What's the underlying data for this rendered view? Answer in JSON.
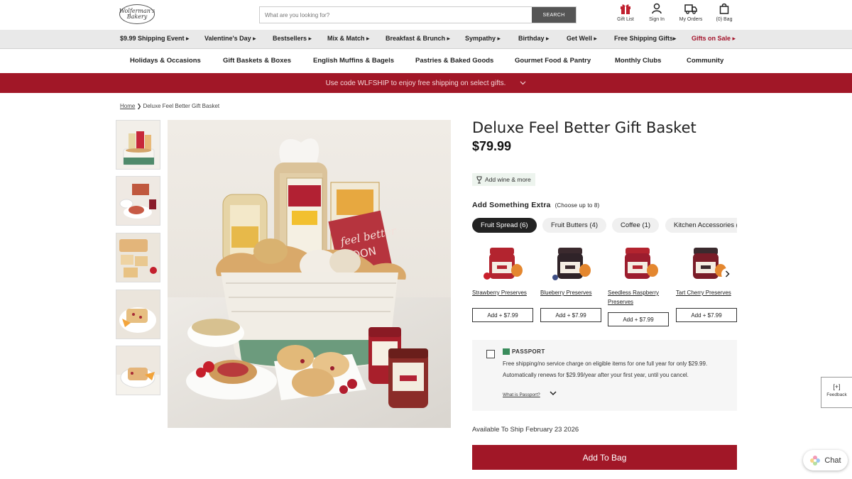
{
  "header": {
    "logo_text": "Wolferman's Bakery",
    "search_placeholder": "What are you looking for?",
    "search_button": "SEARCH",
    "icons": [
      {
        "label": "Gift List",
        "icon": "gift-icon"
      },
      {
        "label": "Sign In",
        "icon": "person-icon"
      },
      {
        "label": "My Orders",
        "icon": "truck-icon"
      },
      {
        "label": "(0) Bag",
        "icon": "bag-icon"
      }
    ]
  },
  "nav_primary": [
    {
      "label": "$9.99 Shipping Event ▸"
    },
    {
      "label": "Valentine's Day ▸"
    },
    {
      "label": "Bestsellers ▸"
    },
    {
      "label": "Mix & Match ▸"
    },
    {
      "label": "Breakfast & Brunch ▸"
    },
    {
      "label": "Sympathy ▸"
    },
    {
      "label": "Birthday ▸"
    },
    {
      "label": "Get Well ▸"
    },
    {
      "label": "Free Shipping Gifts▸"
    },
    {
      "label": "Gifts on Sale ▸"
    }
  ],
  "nav_secondary": [
    {
      "label": "Holidays & Occasions"
    },
    {
      "label": "Gift Baskets & Boxes"
    },
    {
      "label": "English Muffins & Bagels"
    },
    {
      "label": "Pastries & Baked Goods"
    },
    {
      "label": "Gourmet Food & Pantry"
    },
    {
      "label": "Monthly Clubs"
    },
    {
      "label": "Community"
    }
  ],
  "promo": {
    "text": "Use code WLFSHIP to enjoy free shipping on select gifts."
  },
  "breadcrumb": {
    "home": "Home",
    "separator": "❯",
    "current": "Deluxe Feel Better Gift Basket"
  },
  "product": {
    "title": "Deluxe Feel Better Gift Basket",
    "price": "$79.99",
    "wine_link": "Add wine & more",
    "extra_heading": "Add Something Extra",
    "extra_note": "(Choose up to 8)",
    "main_image_text": {
      "line1": "feel better",
      "line2": "SOON"
    }
  },
  "tabs": [
    {
      "label": "Fruit Spread (6)"
    },
    {
      "label": "Fruit Butters (4)"
    },
    {
      "label": "Coffee (1)"
    },
    {
      "label": "Kitchen Accessories ("
    }
  ],
  "addons": [
    {
      "name": "Strawberry Preserves",
      "button": "Add + $7.99",
      "lid": "#b3242f",
      "fill": "#b3242f"
    },
    {
      "name": "Blueberry Preserves",
      "button": "Add + $7.99",
      "lid": "#3b2a2e",
      "fill": "#3b2a2e"
    },
    {
      "name": "Seedless Raspberry Preserves",
      "button": "Add + $7.99",
      "lid": "#b3242f",
      "fill": "#9c1d2e"
    },
    {
      "name": "Tart Cherry Preserves",
      "button": "Add + $7.99",
      "lid": "#3b2a2e",
      "fill": "#7a1c28"
    }
  ],
  "passport": {
    "brand": "PASSPORT",
    "text": "Free shipping/no service charge on eligible items for one full year for only $29.99. Automatically renews for $29.99/year after your first year, until you cancel.",
    "link": "What is Passport?"
  },
  "availability": "Available To Ship February 23 2026",
  "add_to_bag": "Add To Bag",
  "feedback": {
    "symbol": "[+]",
    "label": "Feedback"
  },
  "chat": {
    "label": "Chat"
  },
  "colors": {
    "brand_red": "#a11727",
    "nav_bg": "#e9e9e9",
    "sale_red": "#a3122a"
  }
}
